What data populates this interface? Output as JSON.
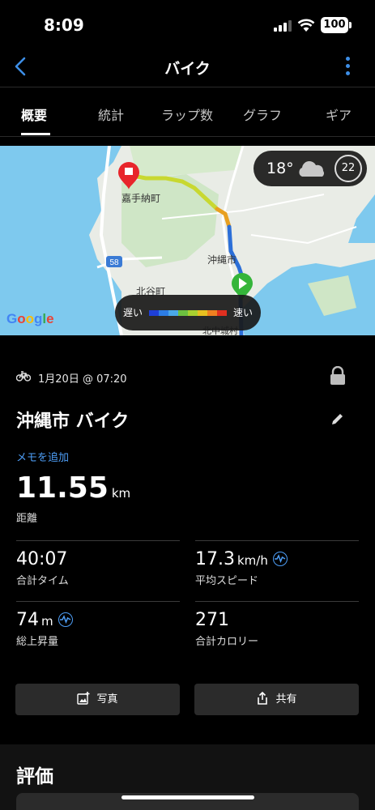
{
  "status_bar": {
    "time": "8:09",
    "battery": "100"
  },
  "header": {
    "title": "バイク"
  },
  "tabs": [
    {
      "label": "概要",
      "active": true
    },
    {
      "label": "統計",
      "active": false
    },
    {
      "label": "ラップ数",
      "active": false
    },
    {
      "label": "グラフ",
      "active": false
    },
    {
      "label": "ギア",
      "active": false
    }
  ],
  "map": {
    "place_labels": [
      "嘉手納町",
      "沖縄市",
      "北谷町",
      "北中城村"
    ],
    "road_number": "58",
    "weather": {
      "temperature": "18°",
      "icon": "cloud-icon",
      "wind": "22"
    },
    "legend": {
      "slow": "遅い",
      "fast": "速い",
      "colors": [
        "#1e3fd8",
        "#2c7de6",
        "#4aa8e8",
        "#6cc040",
        "#a8d030",
        "#e8c020",
        "#f08020",
        "#e03020"
      ]
    },
    "attribution": "Google"
  },
  "activity": {
    "date": "1月20日 @ 07:20",
    "title": "沖縄市 バイク",
    "add_memo": "メモを追加",
    "distance": {
      "value": "11.55",
      "unit": "km",
      "label": "距離"
    },
    "stats": [
      {
        "value": "40:07",
        "unit": "",
        "label": "合計タイム"
      },
      {
        "value": "17.3",
        "unit": "km/h",
        "label": "平均スピード"
      },
      {
        "value": "74",
        "unit": "m",
        "label": "総上昇量"
      },
      {
        "value": "271",
        "unit": "",
        "label": "合計カロリー"
      }
    ]
  },
  "buttons": {
    "photo": "写真",
    "share": "共有"
  },
  "rating": {
    "title": "評価"
  },
  "colors": {
    "accent": "#4d9df5",
    "background": "#000000",
    "button": "#2b2b2b"
  }
}
